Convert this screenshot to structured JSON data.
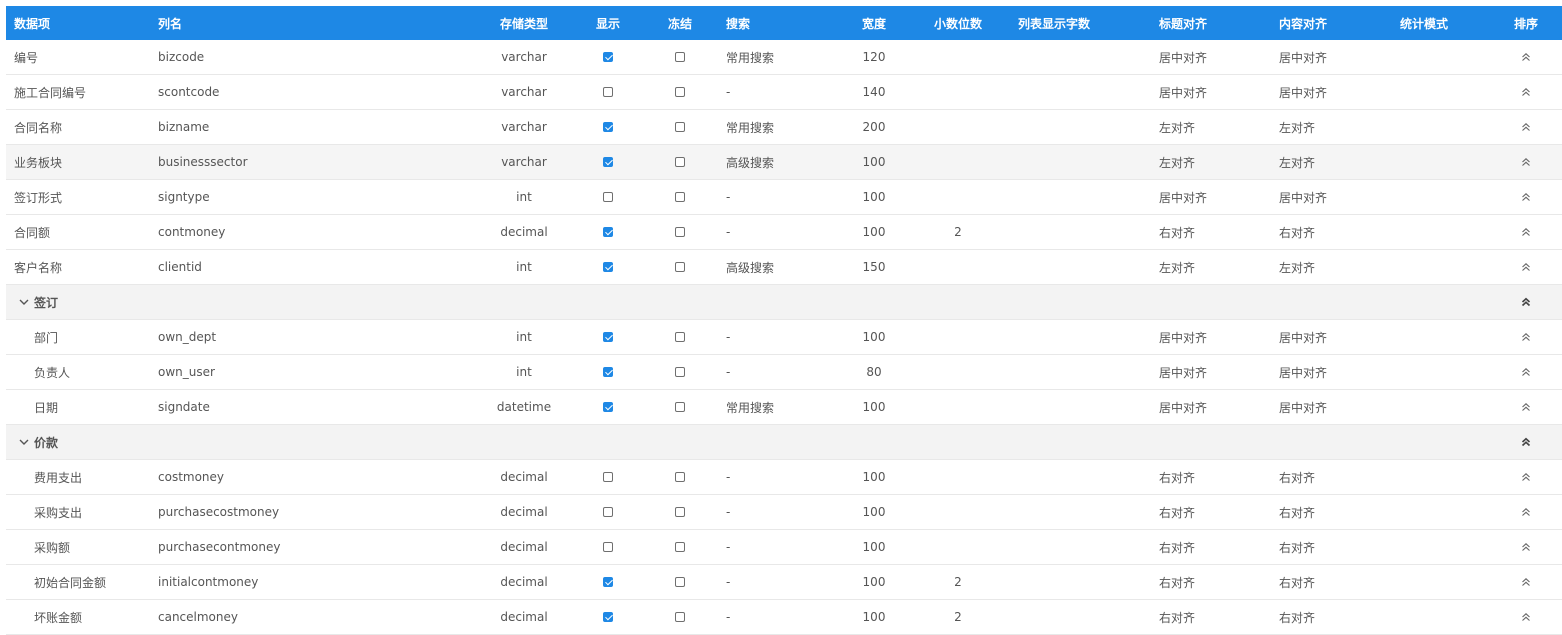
{
  "header": {
    "item": "数据项",
    "column": "列名",
    "type": "存储类型",
    "show": "显示",
    "freeze": "冻结",
    "search": "搜索",
    "width": "宽度",
    "decimals": "小数位数",
    "chars": "列表显示字数",
    "title_align": "标题对齐",
    "content_align": "内容对齐",
    "stat_mode": "统计模式",
    "sort": "排序"
  },
  "rows": [
    {
      "kind": "field",
      "item": "编号",
      "column": "bizcode",
      "type": "varchar",
      "show": true,
      "freeze": false,
      "search": "常用搜索",
      "width": "120",
      "decimals": "",
      "title_align": "居中对齐",
      "content_align": "居中对齐"
    },
    {
      "kind": "field",
      "item": "施工合同编号",
      "column": "scontcode",
      "type": "varchar",
      "show": false,
      "freeze": false,
      "search": "-",
      "width": "140",
      "decimals": "",
      "title_align": "居中对齐",
      "content_align": "居中对齐"
    },
    {
      "kind": "field",
      "item": "合同名称",
      "column": "bizname",
      "type": "varchar",
      "show": true,
      "freeze": false,
      "search": "常用搜索",
      "width": "200",
      "decimals": "",
      "title_align": "左对齐",
      "content_align": "左对齐"
    },
    {
      "kind": "field",
      "highlight": true,
      "item": "业务板块",
      "column": "businesssector",
      "type": "varchar",
      "show": true,
      "freeze": false,
      "search": "高级搜索",
      "width": "100",
      "decimals": "",
      "title_align": "左对齐",
      "content_align": "左对齐"
    },
    {
      "kind": "field",
      "item": "签订形式",
      "column": "signtype",
      "type": "int",
      "show": false,
      "freeze": false,
      "search": "-",
      "width": "100",
      "decimals": "",
      "title_align": "居中对齐",
      "content_align": "居中对齐"
    },
    {
      "kind": "field",
      "item": "合同额",
      "column": "contmoney",
      "type": "decimal",
      "show": true,
      "freeze": false,
      "search": "-",
      "width": "100",
      "decimals": "2",
      "title_align": "右对齐",
      "content_align": "右对齐"
    },
    {
      "kind": "field",
      "item": "客户名称",
      "column": "clientid",
      "type": "int",
      "show": true,
      "freeze": false,
      "search": "高级搜索",
      "width": "150",
      "decimals": "",
      "title_align": "左对齐",
      "content_align": "左对齐"
    },
    {
      "kind": "group",
      "item": "签订"
    },
    {
      "kind": "child",
      "item": "部门",
      "column": "own_dept",
      "type": "int",
      "show": true,
      "freeze": false,
      "search": "-",
      "width": "100",
      "decimals": "",
      "title_align": "居中对齐",
      "content_align": "居中对齐"
    },
    {
      "kind": "child",
      "item": "负责人",
      "column": "own_user",
      "type": "int",
      "show": true,
      "freeze": false,
      "search": "-",
      "width": "80",
      "decimals": "",
      "title_align": "居中对齐",
      "content_align": "居中对齐"
    },
    {
      "kind": "child",
      "item": "日期",
      "column": "signdate",
      "type": "datetime",
      "show": true,
      "freeze": false,
      "search": "常用搜索",
      "width": "100",
      "decimals": "",
      "title_align": "居中对齐",
      "content_align": "居中对齐"
    },
    {
      "kind": "group",
      "item": "价款"
    },
    {
      "kind": "child",
      "item": "费用支出",
      "column": "costmoney",
      "type": "decimal",
      "show": false,
      "freeze": false,
      "search": "-",
      "width": "100",
      "decimals": "",
      "title_align": "右对齐",
      "content_align": "右对齐"
    },
    {
      "kind": "child",
      "item": "采购支出",
      "column": "purchasecostmoney",
      "type": "decimal",
      "show": false,
      "freeze": false,
      "search": "-",
      "width": "100",
      "decimals": "",
      "title_align": "右对齐",
      "content_align": "右对齐"
    },
    {
      "kind": "child",
      "item": "采购额",
      "column": "purchasecontmoney",
      "type": "decimal",
      "show": false,
      "freeze": false,
      "search": "-",
      "width": "100",
      "decimals": "",
      "title_align": "右对齐",
      "content_align": "右对齐"
    },
    {
      "kind": "child",
      "item": "初始合同金额",
      "column": "initialcontmoney",
      "type": "decimal",
      "show": true,
      "freeze": false,
      "search": "-",
      "width": "100",
      "decimals": "2",
      "title_align": "右对齐",
      "content_align": "右对齐"
    },
    {
      "kind": "child",
      "item": "坏账金额",
      "column": "cancelmoney",
      "type": "decimal",
      "show": true,
      "freeze": false,
      "search": "-",
      "width": "100",
      "decimals": "2",
      "title_align": "右对齐",
      "content_align": "右对齐"
    }
  ],
  "colors": {
    "header_bg": "#1e88e5",
    "checkbox_on": "#1e88e5",
    "group_bg": "#f3f3f3"
  },
  "icons": {
    "sort": "double-chevron-up-icon",
    "group_toggle": "chevron-down-icon"
  }
}
